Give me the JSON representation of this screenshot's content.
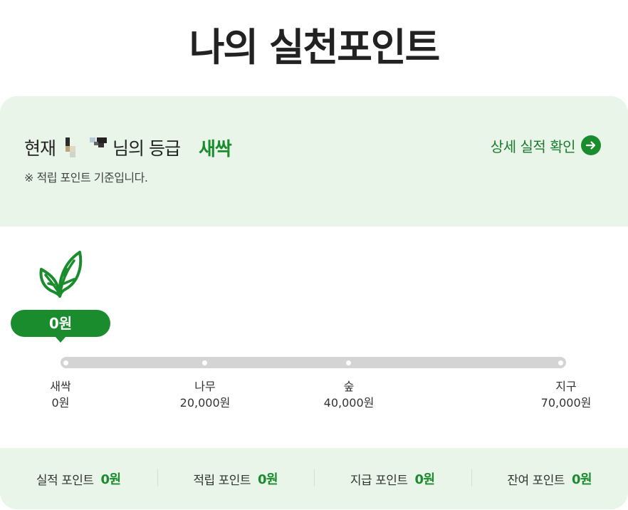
{
  "page": {
    "title": "나의 실천포인트"
  },
  "grade": {
    "prefix": "현재",
    "suffix": "님의 등급",
    "value": "새싹",
    "note": "※ 적립 포인트 기준입니다.",
    "detail_link": "상세 실적 확인",
    "detail_icon": "arrow-right-circle-icon"
  },
  "progress": {
    "current_label": "0원",
    "current_fraction": 0,
    "icon": "sprout-leaf-icon",
    "stages": [
      {
        "name": "새싹",
        "amount": "0원"
      },
      {
        "name": "나무",
        "amount": "20,000원"
      },
      {
        "name": "숲",
        "amount": "40,000원"
      },
      {
        "name": "지구",
        "amount": "70,000원"
      }
    ]
  },
  "summary": [
    {
      "label": "실적 포인트",
      "value": "0원"
    },
    {
      "label": "적립 포인트",
      "value": "0원"
    },
    {
      "label": "지급 포인트",
      "value": "0원"
    },
    {
      "label": "잔여 포인트",
      "value": "0원"
    }
  ],
  "colors": {
    "accent": "#1a8c2e",
    "panel": "#e8f5e8",
    "track": "#d4d4d4"
  }
}
